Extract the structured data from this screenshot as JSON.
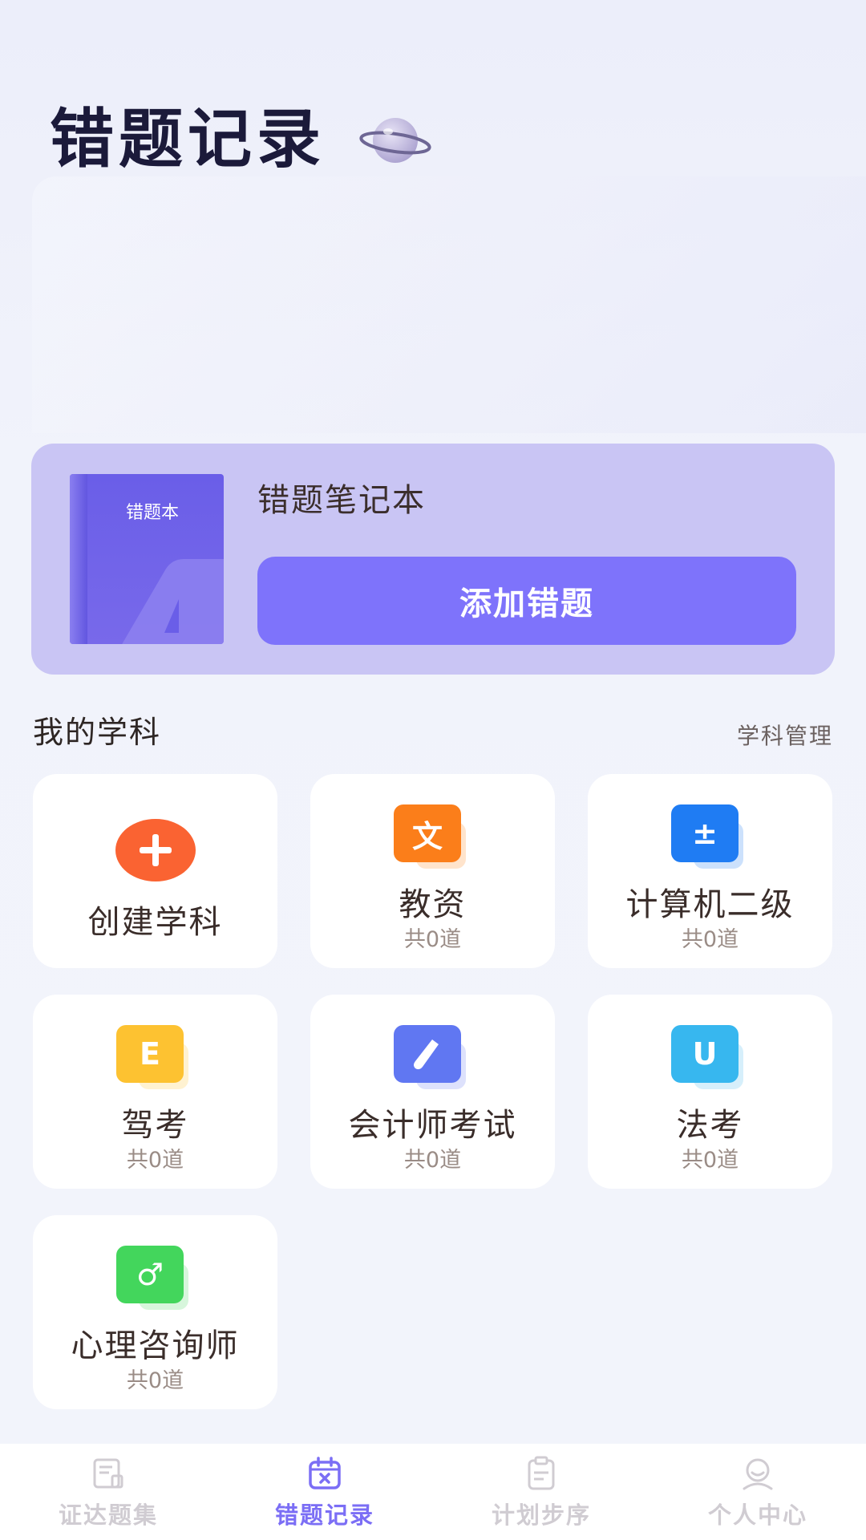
{
  "header": {
    "title": "错题记录"
  },
  "notebook": {
    "book_label": "错题本",
    "title": "错题笔记本",
    "add_button": "添加错题"
  },
  "subjects": {
    "section_title": "我的学科",
    "manage_link": "学科管理",
    "create_label": "创建学科",
    "items": [
      {
        "name": "教资",
        "count": "共0道",
        "icon_text": "文",
        "color": "#fb7e1a",
        "shadow": "#ffc38f"
      },
      {
        "name": "计算机二级",
        "count": "共0道",
        "icon_text": "±",
        "color": "#1f7cf3",
        "shadow": "#8fbcf9"
      },
      {
        "name": "驾考",
        "count": "共0道",
        "icon_text": "E",
        "color": "#fdc231",
        "shadow": "#ffe29a"
      },
      {
        "name": "会计师考试",
        "count": "共0道",
        "icon_text": "",
        "color": "#6077f2",
        "shadow": "#b3bdf8"
      },
      {
        "name": "法考",
        "count": "共0道",
        "icon_text": "U",
        "color": "#37b7ef",
        "shadow": "#a4dcf7"
      },
      {
        "name": "心理咨询师",
        "count": "共0道",
        "icon_text": "♂",
        "color": "#43d65c",
        "shadow": "#a7ecb2"
      }
    ]
  },
  "tabbar": {
    "tabs": [
      {
        "label": "证达题集",
        "icon": "book-icon",
        "active": false
      },
      {
        "label": "错题记录",
        "icon": "calendar-x-icon",
        "active": true
      },
      {
        "label": "计划步序",
        "icon": "clipboard-icon",
        "active": false
      },
      {
        "label": "个人中心",
        "icon": "user-icon",
        "active": false
      }
    ]
  },
  "colors": {
    "accent": "#7e73fb",
    "card_bg": "#c9c5f4",
    "create_orange": "#fa6332",
    "tab_active": "#7b6ef5",
    "tab_inactive": "#d0ccd2"
  }
}
